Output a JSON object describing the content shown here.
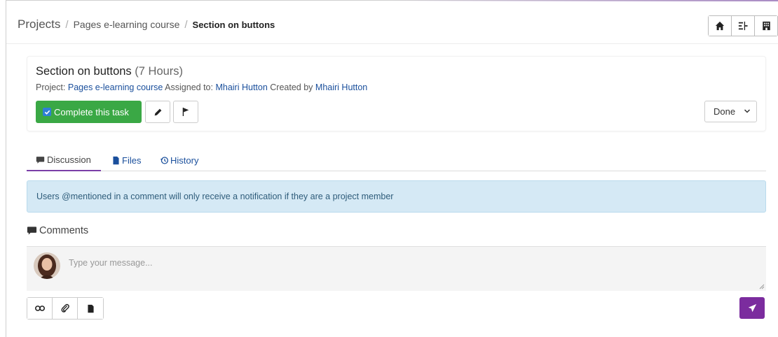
{
  "breadcrumb": {
    "root": "Projects",
    "separator": "/",
    "project": "Pages e-learning course",
    "current": "Section on buttons"
  },
  "header_icons": [
    "home-icon",
    "gantt-icon",
    "building-icon"
  ],
  "task": {
    "title": "Section on buttons",
    "hours": "(7 Hours)",
    "project_label": "Project:",
    "project_name": "Pages e-learning course",
    "assigned_label": "Assigned to:",
    "assignee": "Mhairi Hutton",
    "created_label": "Created by",
    "creator": "Mhairi Hutton",
    "complete_label": "Complete this task",
    "complete_checked": true,
    "status": "Done"
  },
  "tabs": [
    {
      "label": "Discussion",
      "icon": "comment-icon",
      "active": true
    },
    {
      "label": "Files",
      "icon": "file-icon",
      "active": false
    },
    {
      "label": "History",
      "icon": "history-icon",
      "active": false
    }
  ],
  "alert_text": "Users @mentioned in a comment will only receive a notification if they are a project member",
  "comments": {
    "title": "Comments",
    "placeholder": "Type your message..."
  },
  "toolbar_icons": [
    "link-icon",
    "paperclip-icon",
    "document-icon",
    "send-icon"
  ],
  "colors": {
    "complete_button": "#3aa845",
    "send_button": "#7b2c9e",
    "link": "#1a4f9c",
    "alert_bg": "#d5e9f5",
    "active_tab_underline": "#7b3fa8"
  }
}
